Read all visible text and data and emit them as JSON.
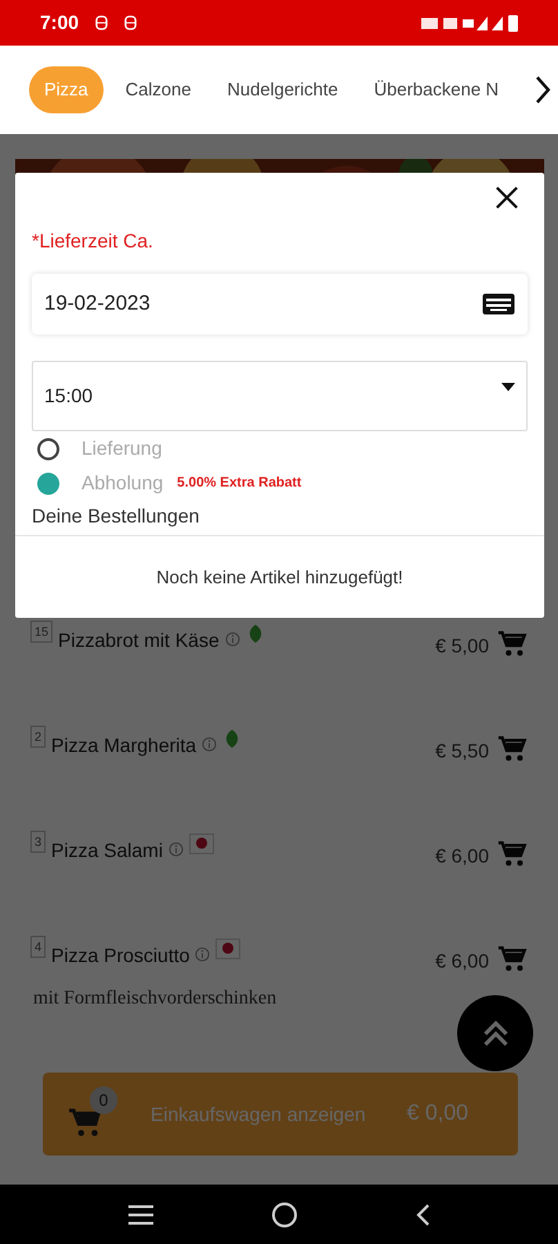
{
  "status_bar": {
    "time": "7:00"
  },
  "tabs": [
    {
      "label": "Pizza",
      "selected": true
    },
    {
      "label": "Calzone",
      "selected": false
    },
    {
      "label": "Nudelgerichte",
      "selected": false
    },
    {
      "label": "Überbackene N",
      "selected": false
    }
  ],
  "menu_items": [
    {
      "number": "15",
      "name": "Pizzabrot mit Käse",
      "kind": "vegetarian",
      "price": "€ 5,00"
    },
    {
      "number": "2",
      "name": "Pizza Margherita",
      "kind": "vegetarian",
      "price": "€ 5,50"
    },
    {
      "number": "3",
      "name": "Pizza Salami",
      "kind": "meat",
      "price": "€ 6,00"
    },
    {
      "number": "4",
      "name": "Pizza Prosciutto",
      "kind": "meat",
      "price": "€ 6,00",
      "description": "mit Formfleischvorderschinken"
    }
  ],
  "cart": {
    "count": "0",
    "label": "Einkaufswagen anzeigen",
    "total": "€ 0,00"
  },
  "dialog": {
    "label": "*Lieferzeit Ca.",
    "date": "19-02-2023",
    "time": "15:00",
    "options": [
      {
        "label": "Lieferung",
        "selected": false
      },
      {
        "label": "Abholung",
        "selected": true,
        "note": "5.00% Extra Rabatt"
      }
    ],
    "orders_heading": "Deine Bestellungen",
    "empty_message": "Noch keine Artikel hinzugefügt!"
  }
}
